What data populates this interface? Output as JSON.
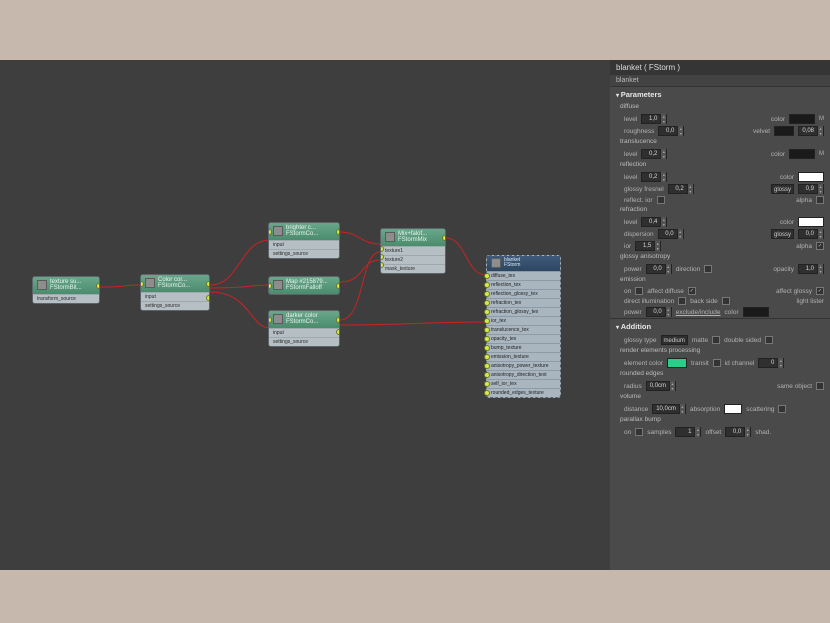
{
  "panel": {
    "title": "blanket  ( FStorm )",
    "object": "blanket",
    "sections": {
      "parameters": "Parameters",
      "addition": "Addition"
    },
    "groups": {
      "diffuse": "diffuse",
      "translucence": "translucence",
      "reflection": "reflection",
      "refraction": "refraction",
      "glossy_aniso": "glossy anisotropy",
      "emission": "emission",
      "render_elems": "render elements processing",
      "rounded": "rounded edges",
      "volume": "volume",
      "parallax": "parallax bump"
    },
    "labels": {
      "level": "level",
      "roughness": "roughness",
      "color": "color",
      "velvet": "velvet",
      "glossy_fresnel": "glossy fresnel",
      "reflect_ior": "reflect. ior",
      "alpha": "alpha",
      "dispersion": "dispersion",
      "ior": "ior",
      "power": "power",
      "direction": "direction",
      "opacity": "opacity",
      "on": "on",
      "affect_diffuse": "affect diffuse",
      "affect_glossy": "affect glossy",
      "direct_illum": "direct illumination",
      "back_side": "back side",
      "light_lister": "light lister",
      "exclude_include": "exclude/include",
      "glossy_type": "glossy type",
      "matte": "matte",
      "double_sided": "double sided",
      "element_color": "element color",
      "transit": "transit",
      "id_channel": "id channel",
      "radius": "radius",
      "same_object": "same object",
      "distance": "distance",
      "absorption": "absorption",
      "scattering": "scattering",
      "samples": "samples",
      "offset": "offset",
      "shad": "shad."
    },
    "values": {
      "diffuse_level": "1,0",
      "diffuse_roughness": "0,0",
      "velvet": "0,08",
      "trans_level": "0,2",
      "refl_level": "0,2",
      "glossy_fresnel": "0,2",
      "glossy_drop": "glossy",
      "glossy_val": "0,9",
      "refr_level": "0,4",
      "dispersion": "0,0",
      "disp_val": "0,0",
      "ior": "1,5",
      "aniso_power": "0,0",
      "aniso_opacity": "1,0",
      "emit_power": "0,0",
      "glossy_type": "medium",
      "id_channel": "0",
      "rounded_radius": "0,0cm",
      "volume_distance": "10,0cm",
      "px_samples": "1",
      "px_offset": "0,0"
    },
    "colors": {
      "diffuse": "#1a1a1a",
      "velvet": "#1a1a1a",
      "trans": "#1a1a1a",
      "refl": "#ffffff",
      "refr": "#ffffff",
      "element": "#26d089",
      "emit": "#1a1a1a",
      "absorption": "#ffffff"
    }
  },
  "nodes": {
    "n1": {
      "title": "texture su...",
      "sub": "FStormBit...",
      "rows": [
        "transform_source"
      ]
    },
    "n2": {
      "title": "Color cor...",
      "sub": "FStormCo...",
      "rows": [
        "input",
        "settings_source"
      ]
    },
    "n3": {
      "title": "brighter c...",
      "sub": "FStormCo...",
      "rows": [
        "input",
        "settings_source"
      ]
    },
    "n4": {
      "title": "Map #215879...",
      "sub": "FStormFalloff",
      "rows": []
    },
    "n5": {
      "title": "darker color",
      "sub": "FStormCo...",
      "rows": [
        "input",
        "settings_source"
      ]
    },
    "n6": {
      "title": "Mix+falof...",
      "sub": "FStormMix",
      "rows": [
        "texture1",
        "texture2",
        "mask_texture"
      ]
    },
    "target": {
      "title": "blanket",
      "sub": "FStorm",
      "rows": [
        "diffuse_tex",
        "reflection_tex",
        "reflection_glossy_tex",
        "refraction_tex",
        "refraction_glossy_tex",
        "ior_tex",
        "translucence_tex",
        "opacity_tex",
        "bump_texture",
        "emission_texture",
        "anisotropy_power_texture",
        "anisotropy_direction_text",
        "self_ior_tex",
        "rounded_edges_texture"
      ]
    }
  }
}
